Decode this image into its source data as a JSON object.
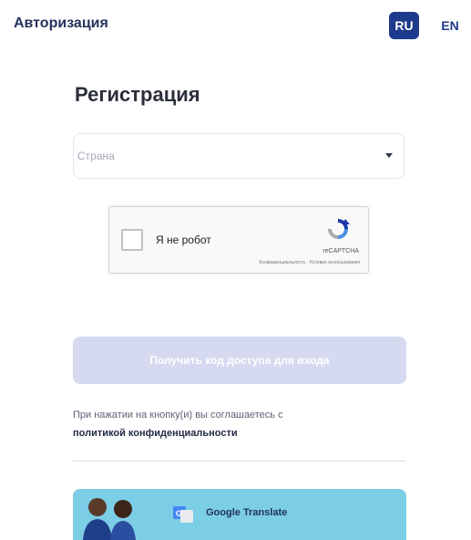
{
  "header": {
    "auth_link": "Авторизация",
    "languages": [
      {
        "code": "RU",
        "active": true
      },
      {
        "code": "EN",
        "active": false
      }
    ]
  },
  "form": {
    "title": "Регистрация",
    "country_placeholder": "Страна",
    "submit_label": "Получить код доступа для входа",
    "consent_text": "При нажатии на кнопку(и) вы соглашаетесь с",
    "policy_link": "политикой конфиденциальности"
  },
  "captcha": {
    "label": "Я не робот",
    "brand": "reCAPTCHA",
    "terms": "Конфиденциальность - Условия использования"
  },
  "banner": {
    "label": "Google Translate"
  },
  "colors": {
    "brand_navy": "#1e3a8c",
    "button_disabled": "#d5daf0",
    "banner_bg": "#7ccde6"
  }
}
